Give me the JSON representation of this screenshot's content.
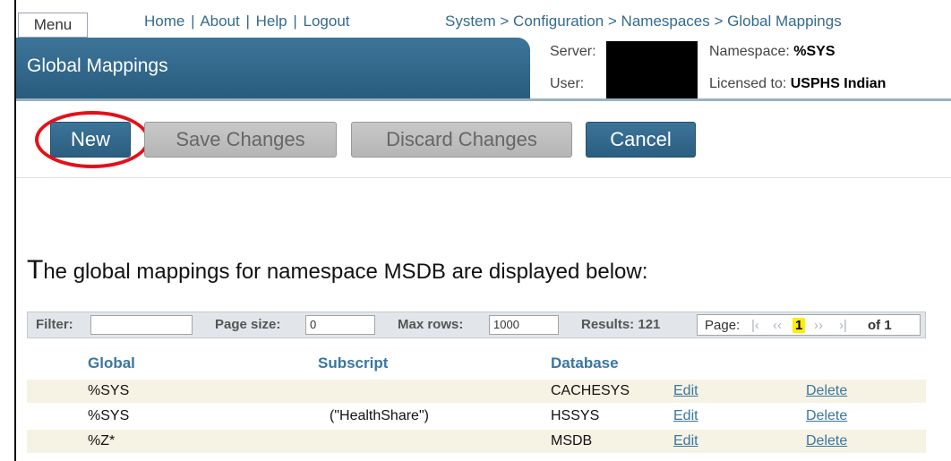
{
  "header": {
    "menu_label": "Menu",
    "links": [
      "Home",
      "About",
      "Help",
      "Logout"
    ],
    "link_separator": "|",
    "breadcrumb": "System > Configuration > Namespaces > Global Mappings",
    "page_title": "Global Mappings",
    "server_label": "Server:",
    "user_label": "User:",
    "namespace_label": "Namespace:",
    "namespace_value": "%SYS",
    "licensed_label": "Licensed to:",
    "licensed_value": "USPHS Indian"
  },
  "toolbar": {
    "new_label": "New",
    "save_label": "Save Changes",
    "discard_label": "Discard Changes",
    "cancel_label": "Cancel"
  },
  "description": {
    "first_letter": "T",
    "rest": "he global mappings for namespace MSDB are displayed below:"
  },
  "filter_bar": {
    "filter_label": "Filter:",
    "filter_value": "",
    "page_size_label": "Page size:",
    "page_size_value": "0",
    "max_rows_label": "Max rows:",
    "max_rows_value": "1000",
    "results_label": "Results: 121",
    "page_label": "Page:",
    "first": "|‹",
    "prev": "‹‹",
    "current_page": "1",
    "next": "››",
    "last": "›|",
    "of_label": "of 1"
  },
  "table": {
    "columns": [
      "Global",
      "Subscript",
      "Database"
    ],
    "rows": [
      {
        "global": "%SYS",
        "subscript": "",
        "database": "CACHESYS",
        "edit": "Edit",
        "delete": "Delete"
      },
      {
        "global": "%SYS",
        "subscript": "(\"HealthShare\")",
        "database": "HSSYS",
        "edit": "Edit",
        "delete": "Delete"
      },
      {
        "global": "%Z*",
        "subscript": "",
        "database": "MSDB",
        "edit": "Edit",
        "delete": "Delete"
      }
    ]
  },
  "colors": {
    "title_bar": "#2f6688",
    "link": "#346b8e",
    "highlight_circle": "#e4101a",
    "current_page": "#ffee00"
  }
}
